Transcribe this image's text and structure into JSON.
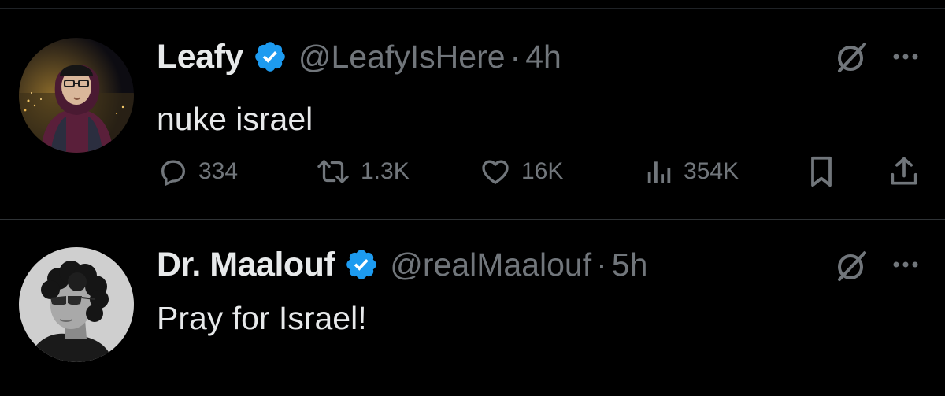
{
  "tweets": [
    {
      "display_name": "Leafy",
      "handle": "@LeafyIsHere",
      "separator": "·",
      "time": "4h",
      "text": "nuke israel",
      "verified_icon": "verified-badge-icon",
      "stats": {
        "replies": "334",
        "reposts": "1.3K",
        "likes": "16K",
        "views": "354K"
      }
    },
    {
      "display_name": "Dr. Maalouf",
      "handle": "@realMaalouf",
      "separator": "·",
      "time": "5h",
      "text": "Pray for Israel!",
      "verified_icon": "verified-badge-icon"
    }
  ],
  "colors": {
    "background": "#000000",
    "primary_text": "#e7e9ea",
    "secondary_text": "#71767b",
    "verified_blue": "#1d9bf0",
    "divider": "#2f3336"
  }
}
